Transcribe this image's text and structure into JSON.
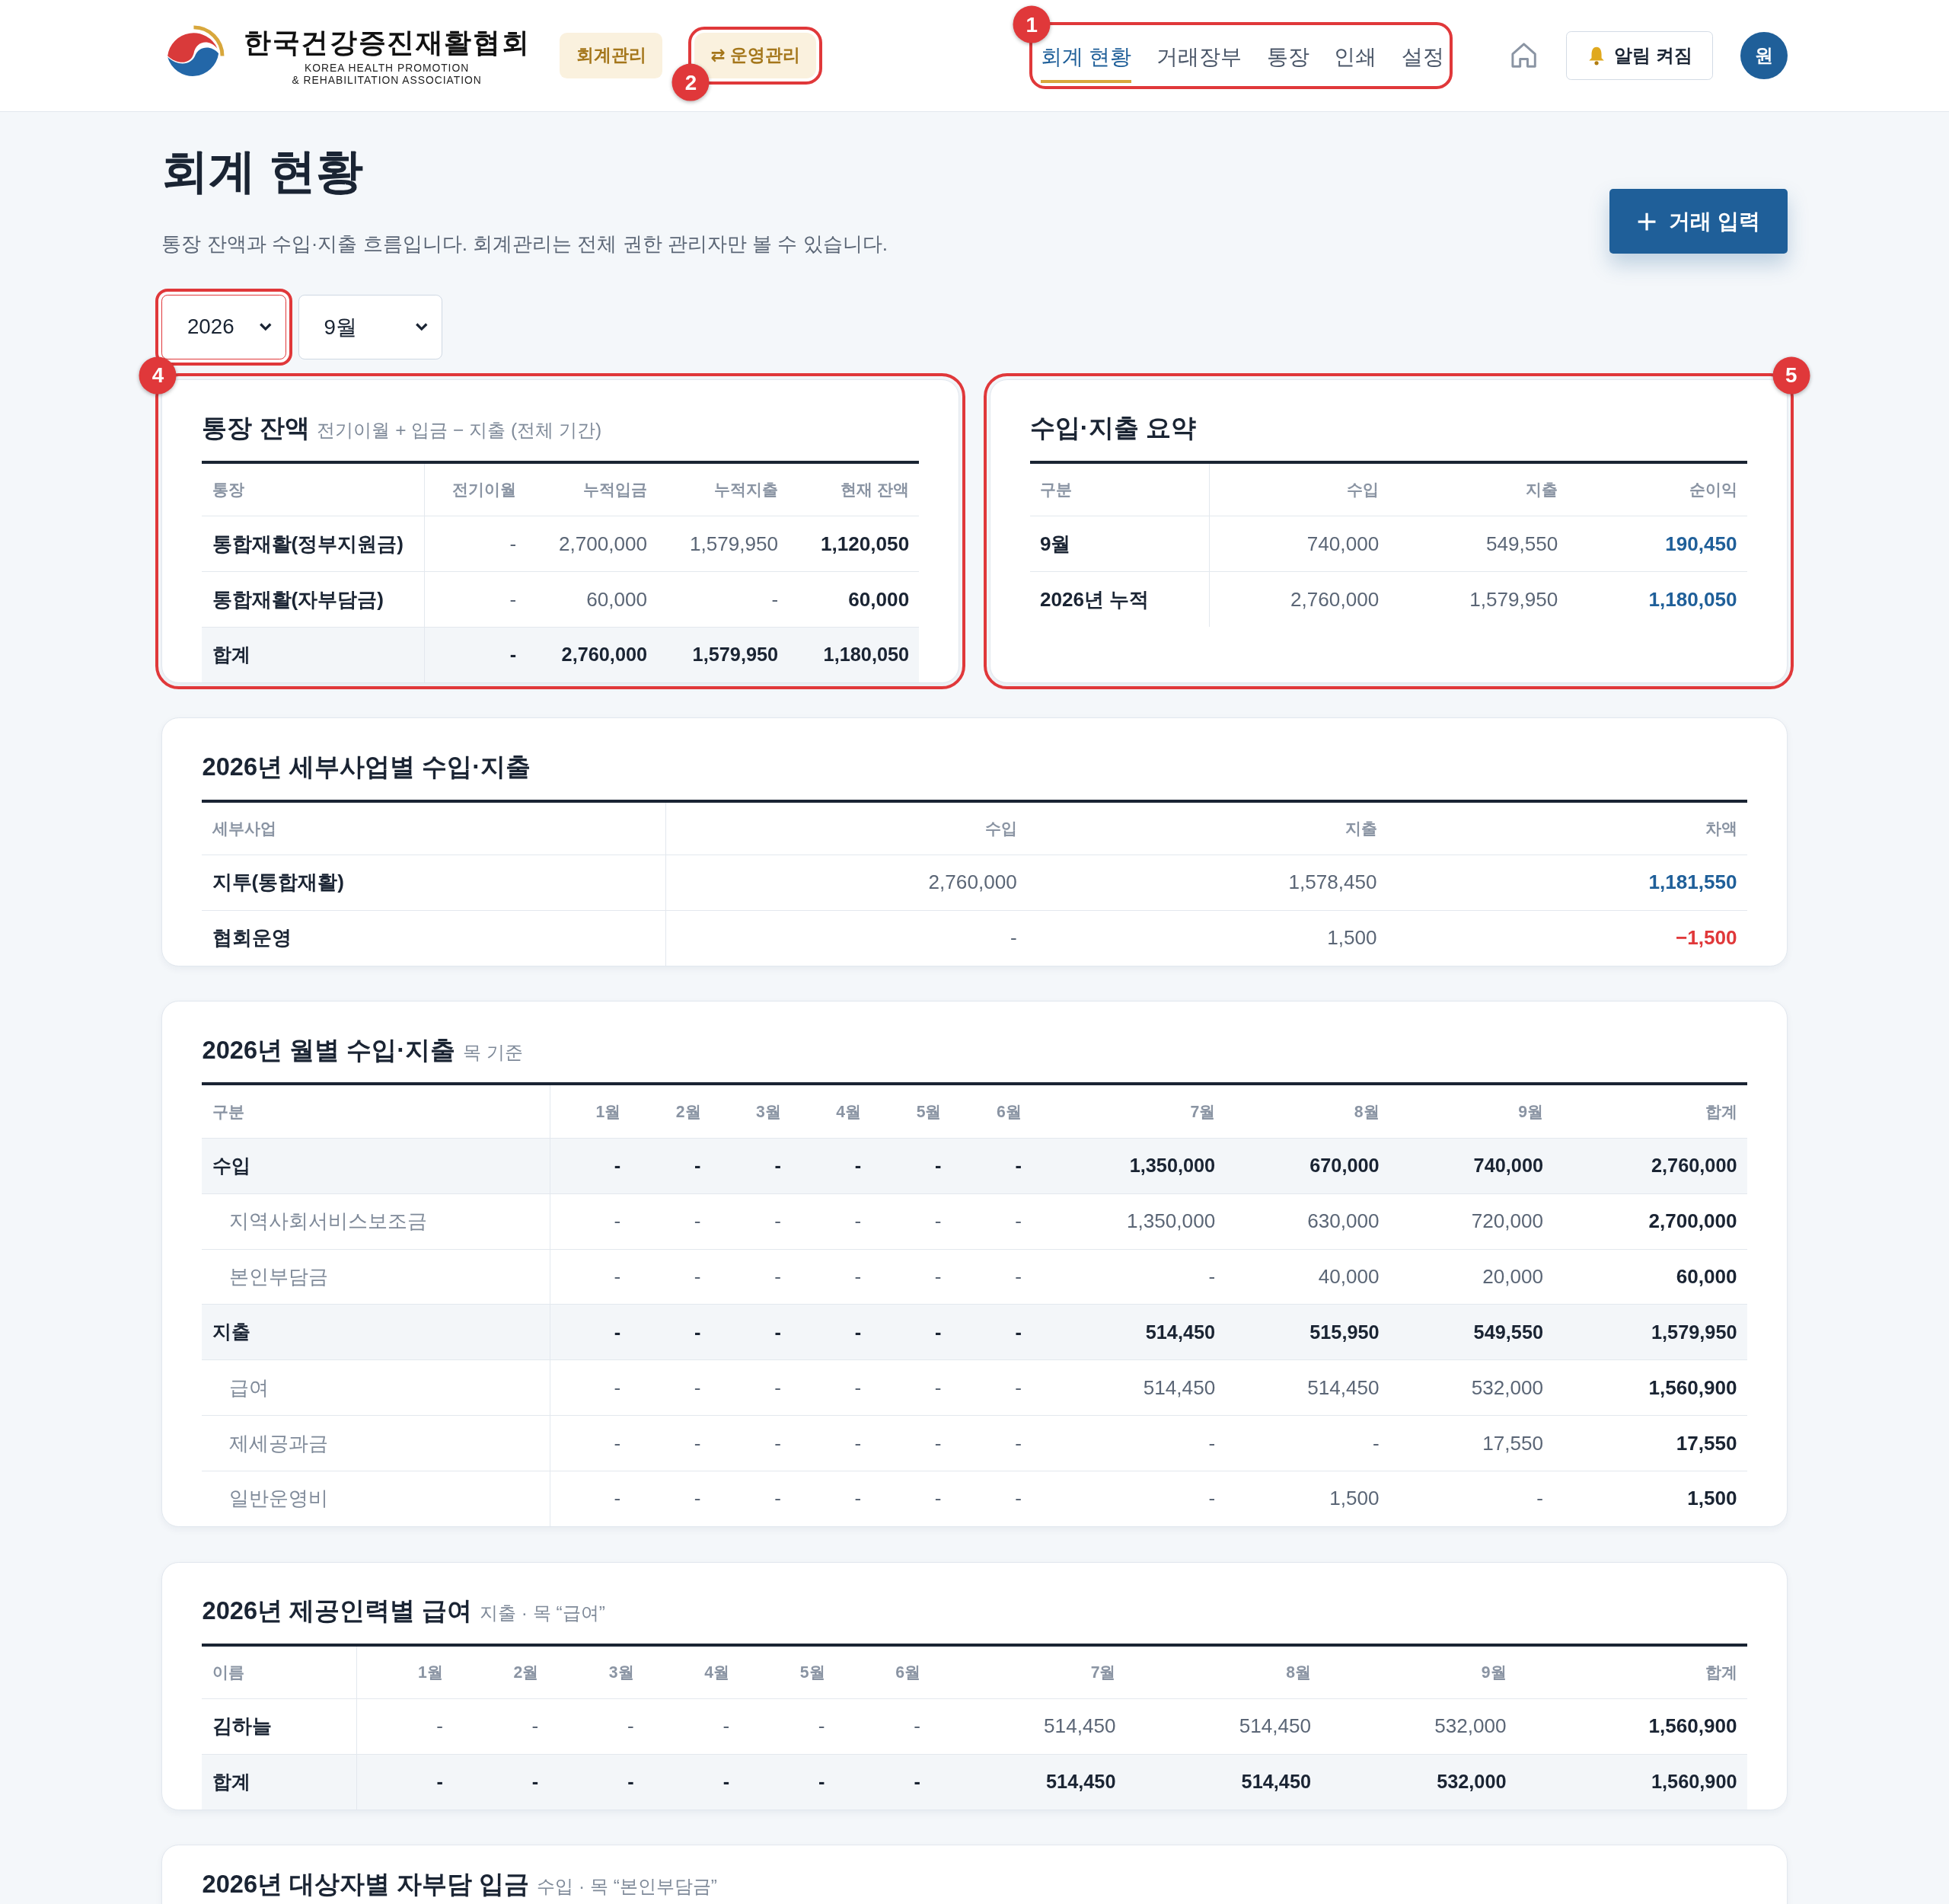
{
  "header": {
    "logo": {
      "name": "한국건강증진재활협회",
      "subtitle_lines": [
        "KOREA HEALTH PROMOTION",
        "& REHABILITATION ASSOCIATION"
      ]
    },
    "mode_buttons": [
      {
        "label": "회계관리"
      },
      {
        "label": "⇄ 운영관리",
        "callout": "2"
      }
    ],
    "nav": {
      "callout": "1",
      "items": [
        {
          "label": "회계 현황",
          "selected": true
        },
        {
          "label": "거래장부",
          "selected": false
        },
        {
          "label": "통장",
          "selected": false
        },
        {
          "label": "인쇄",
          "selected": false
        },
        {
          "label": "설정",
          "selected": false
        }
      ]
    },
    "alert_button": {
      "label": "알림 켜짐"
    },
    "avatar": "원"
  },
  "page": {
    "title": "회계 현황",
    "description": "통장 잔액과 수입·지출 흐름입니다. 회계관리는 전체 권한 관리자만 볼 수 있습니다.",
    "add_button": "거래 입력"
  },
  "filters": [
    {
      "value": "2026",
      "highlighted": true
    },
    {
      "value": "9월",
      "highlighted": false
    }
  ],
  "cards": [
    {
      "title": "통장 잔액",
      "subtitle": "전기이월 + 입금 − 지출 (전체 기간)",
      "half": true,
      "callout": "4",
      "columns": [
        "통장",
        "전기이월",
        "누적입금",
        "누적지출",
        "현재 잔액"
      ],
      "rows": [
        {
          "kind": "plain",
          "cells": [
            "통합재활(정부지원금)",
            "-",
            "2,700,000",
            "1,579,950",
            "1,120,050"
          ]
        },
        {
          "kind": "plain",
          "cells": [
            "통합재활(자부담금)",
            "-",
            "60,000",
            "-",
            "60,000"
          ]
        },
        {
          "kind": "total",
          "cells": [
            "합계",
            "-",
            "2,760,000",
            "1,579,950",
            "1,180,050"
          ]
        }
      ]
    },
    {
      "title": "수입·지출 요약",
      "half": true,
      "callout": "5",
      "colored_net": true,
      "columns": [
        "구분",
        "수입",
        "지출",
        "순이익"
      ],
      "rows": [
        {
          "kind": "plain",
          "negative": false,
          "cells": [
            "9월",
            "740,000",
            "549,550",
            "190,450"
          ]
        },
        {
          "kind": "plain",
          "negative": false,
          "cells": [
            "2026년 누적",
            "2,760,000",
            "1,579,950",
            "1,180,050"
          ]
        }
      ]
    },
    {
      "title": "2026년 세부사업별 수입·지출",
      "half": false,
      "colored_net": true,
      "columns": [
        "세부사업",
        "수입",
        "지출",
        "차액"
      ],
      "rows": [
        {
          "kind": "plain",
          "negative": false,
          "cells": [
            "지투(통합재활)",
            "2,760,000",
            "1,578,450",
            "1,181,550"
          ]
        },
        {
          "kind": "plain",
          "negative": true,
          "cells": [
            "협회운영",
            "-",
            "1,500",
            "−1,500"
          ]
        }
      ]
    },
    {
      "title": "2026년 월별 수입·지출",
      "subtitle": "목 기준",
      "half": false,
      "columns": [
        "구분",
        "1월",
        "2월",
        "3월",
        "4월",
        "5월",
        "6월",
        "7월",
        "8월",
        "9월",
        "합계"
      ],
      "rows": [
        {
          "kind": "group",
          "cells": [
            "수입",
            "-",
            "-",
            "-",
            "-",
            "-",
            "-",
            "1,350,000",
            "670,000",
            "740,000",
            "2,760,000"
          ]
        },
        {
          "kind": "item",
          "cells": [
            "지역사회서비스보조금",
            "-",
            "-",
            "-",
            "-",
            "-",
            "-",
            "1,350,000",
            "630,000",
            "720,000",
            "2,700,000"
          ]
        },
        {
          "kind": "item",
          "cells": [
            "본인부담금",
            "-",
            "-",
            "-",
            "-",
            "-",
            "-",
            "-",
            "40,000",
            "20,000",
            "60,000"
          ]
        },
        {
          "kind": "group",
          "cells": [
            "지출",
            "-",
            "-",
            "-",
            "-",
            "-",
            "-",
            "514,450",
            "515,950",
            "549,550",
            "1,579,950"
          ]
        },
        {
          "kind": "item",
          "cells": [
            "급여",
            "-",
            "-",
            "-",
            "-",
            "-",
            "-",
            "514,450",
            "514,450",
            "532,000",
            "1,560,900"
          ]
        },
        {
          "kind": "item",
          "cells": [
            "제세공과금",
            "-",
            "-",
            "-",
            "-",
            "-",
            "-",
            "-",
            "-",
            "17,550",
            "17,550"
          ]
        },
        {
          "kind": "item",
          "cells": [
            "일반운영비",
            "-",
            "-",
            "-",
            "-",
            "-",
            "-",
            "-",
            "1,500",
            "-",
            "1,500"
          ]
        }
      ]
    },
    {
      "title": "2026년 제공인력별 급여",
      "subtitle": "지출 · 목 “급여”",
      "half": false,
      "columns": [
        "이름",
        "1월",
        "2월",
        "3월",
        "4월",
        "5월",
        "6월",
        "7월",
        "8월",
        "9월",
        "합계"
      ],
      "rows": [
        {
          "kind": "plain",
          "cells": [
            "김하늘",
            "-",
            "-",
            "-",
            "-",
            "-",
            "-",
            "514,450",
            "514,450",
            "532,000",
            "1,560,900"
          ]
        },
        {
          "kind": "total",
          "cells": [
            "합계",
            "-",
            "-",
            "-",
            "-",
            "-",
            "-",
            "514,450",
            "514,450",
            "532,000",
            "1,560,900"
          ]
        }
      ]
    },
    {
      "title": "2026년 대상자별 자부담 입금",
      "subtitle": "수입 · 목 “본인부담금”",
      "half": false
    }
  ]
}
